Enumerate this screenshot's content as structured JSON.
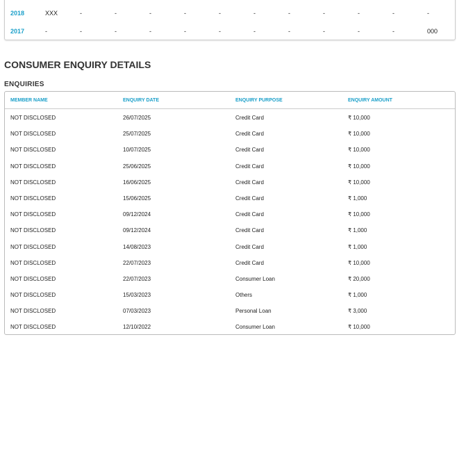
{
  "history": [
    {
      "year": "2018",
      "values": [
        "XXX",
        "-",
        "-",
        "-",
        "-",
        "-",
        "-",
        "-",
        "-",
        "-",
        "-",
        "-"
      ]
    },
    {
      "year": "2017",
      "values": [
        "-",
        "-",
        "-",
        "-",
        "-",
        "-",
        "-",
        "-",
        "-",
        "-",
        "-",
        "000"
      ]
    }
  ],
  "section_title": "CONSUMER ENQUIRY DETAILS",
  "subsection_title": "ENQUIRIES",
  "columns": [
    "MEMBER NAME",
    "ENQUIRY DATE",
    "ENQUIRY PURPOSE",
    "ENQUIRY AMOUNT"
  ],
  "rows": [
    [
      "NOT DISCLOSED",
      "26/07/2025",
      "Credit Card",
      "₹ 10,000"
    ],
    [
      "NOT DISCLOSED",
      "25/07/2025",
      "Credit Card",
      "₹ 10,000"
    ],
    [
      "NOT DISCLOSED",
      "10/07/2025",
      "Credit Card",
      "₹ 10,000"
    ],
    [
      "NOT DISCLOSED",
      "25/06/2025",
      "Credit Card",
      "₹ 10,000"
    ],
    [
      "NOT DISCLOSED",
      "16/06/2025",
      "Credit Card",
      "₹ 10,000"
    ],
    [
      "NOT DISCLOSED",
      "15/06/2025",
      "Credit Card",
      "₹ 1,000"
    ],
    [
      "NOT DISCLOSED",
      "09/12/2024",
      "Credit Card",
      "₹ 10,000"
    ],
    [
      "NOT DISCLOSED",
      "09/12/2024",
      "Credit Card",
      "₹ 1,000"
    ],
    [
      "NOT DISCLOSED",
      "14/08/2023",
      "Credit Card",
      "₹ 1,000"
    ],
    [
      "NOT DISCLOSED",
      "22/07/2023",
      "Credit Card",
      "₹ 10,000"
    ],
    [
      "NOT DISCLOSED",
      "22/07/2023",
      "Consumer Loan",
      "₹ 20,000"
    ],
    [
      "NOT DISCLOSED",
      "15/03/2023",
      "Others",
      "₹ 1,000"
    ],
    [
      "NOT DISCLOSED",
      "07/03/2023",
      "Personal Loan",
      "₹ 3,000"
    ],
    [
      "NOT DISCLOSED",
      "12/10/2022",
      "Consumer Loan",
      "₹ 10,000"
    ]
  ]
}
